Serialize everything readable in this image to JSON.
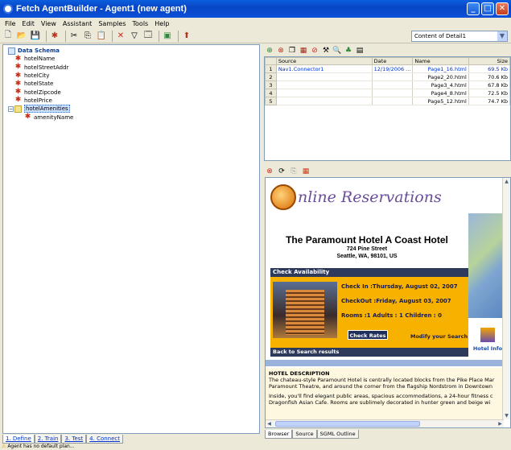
{
  "window": {
    "title": "Fetch AgentBuilder - Agent1 (new agent)"
  },
  "menu": [
    "File",
    "Edit",
    "View",
    "Assistant",
    "Samples",
    "Tools",
    "Help"
  ],
  "toolbar": {
    "combo_value": "Content of Detail1",
    "icons": [
      "new-icon",
      "open-icon",
      "save-icon",
      "agent-icon",
      "cut-icon",
      "copy-icon",
      "paste-icon",
      "delete-icon",
      "filter-icon",
      "properties-icon",
      "export-icon",
      "run-icon"
    ]
  },
  "schema": {
    "root": "Data Schema",
    "fields": [
      "hotelName",
      "hotelStreetAddr",
      "hotelCity",
      "hotelState",
      "hotelZipcode",
      "hotelPrice"
    ],
    "group": "hotelAmenities",
    "group_children": [
      "amenityName"
    ]
  },
  "left_tabs": [
    "1. Define",
    "2. Train",
    "3. Test",
    "4. Connect"
  ],
  "status": "Agent has no default plan...",
  "results": {
    "headers": [
      "Source",
      "Date",
      "Name",
      "Size"
    ],
    "rows": [
      {
        "n": "1",
        "source": "Nav1.Connector1",
        "date": "12/19/2006 ...",
        "name": "Page1_16.html",
        "size": "69.5 Kb"
      },
      {
        "n": "2",
        "source": "",
        "date": "",
        "name": "Page2_20.html",
        "size": "70.6 Kb"
      },
      {
        "n": "3",
        "source": "",
        "date": "",
        "name": "Page3_4.html",
        "size": "67.8 Kb"
      },
      {
        "n": "4",
        "source": "",
        "date": "",
        "name": "Page4_8.html",
        "size": "72.5 Kb"
      },
      {
        "n": "5",
        "source": "",
        "date": "",
        "name": "Page5_12.html",
        "size": "74.7 Kb"
      }
    ]
  },
  "page": {
    "logo_text": "nline Reservations",
    "hotel_name": "The Paramount Hotel A Coast Hotel",
    "street": "724 Pine Street",
    "city": "Seattle, WA, 98101, US",
    "check_availability": "Check Availability",
    "check_in": "Check In  :Thursday, August 02, 2007",
    "check_out": "CheckOut :Friday, August 03, 2007",
    "rooms": "Rooms     :1    Adults :  1    Children : 0",
    "check_rates": "Check Rates",
    "modify": "Modify your Search",
    "back": "Back to Search results",
    "hotel_info": "Hotel Info",
    "desc_title": "HOTEL DESCRIPTION",
    "desc_p1": "The chateau-style Paramount Hotel is centrally located blocks from the Pike Place Mar",
    "desc_p1b": "Paramount Theatre, and around the corner from the flagship Nordstrom in Downtown",
    "desc_p2": "Inside, you'll find elegant public areas, spacious accommodations, a 24-hour fitness c",
    "desc_p2b": "Dragonfish Asian Cafe. Rooms are sublimely decorated in hunter green and beige wi"
  },
  "browser_tabs": [
    "Browser",
    "Source",
    "SGML Outline"
  ]
}
